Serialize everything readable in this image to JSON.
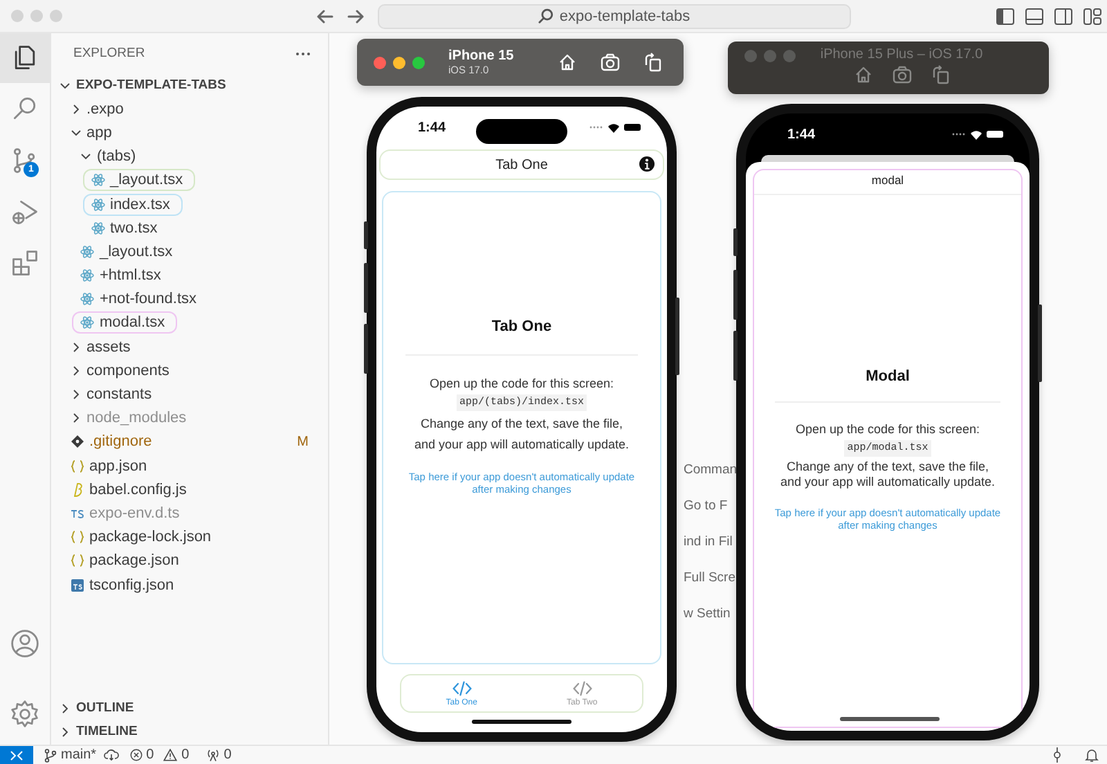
{
  "titlebar": {
    "search": "expo-template-tabs"
  },
  "activity_bar": [
    {
      "kind": "files",
      "selected": true
    },
    {
      "kind": "search",
      "selected": false
    },
    {
      "kind": "source-control",
      "selected": false,
      "badge": "1"
    },
    {
      "kind": "run",
      "selected": false
    },
    {
      "kind": "extensions",
      "selected": false
    },
    {
      "kind": "account",
      "selected": false
    },
    {
      "kind": "settings",
      "selected": false
    }
  ],
  "sidebar": {
    "title": "EXPLORER",
    "root": {
      "label": "EXPO-TEMPLATE-TABS",
      "kind": "folder",
      "expanded": true,
      "children": [
        {
          "label": ".expo",
          "kind": "folder",
          "expanded": false
        },
        {
          "label": "app",
          "kind": "folder",
          "expanded": true,
          "children": [
            {
              "label": "(tabs)",
              "kind": "folder",
              "expanded": true,
              "children": [
                {
                  "label": "_layout.tsx",
                  "kind": "react",
                  "color": "#d6e8c8"
                },
                {
                  "label": "index.tsx",
                  "kind": "react",
                  "color": "#bfe3f5"
                },
                {
                  "label": "two.tsx",
                  "kind": "react"
                }
              ]
            },
            {
              "label": "_layout.tsx",
              "kind": "react"
            },
            {
              "label": "+html.tsx",
              "kind": "react"
            },
            {
              "label": "+not-found.tsx",
              "kind": "react"
            },
            {
              "label": "modal.tsx",
              "kind": "react",
              "color": "#efc6f2"
            }
          ]
        },
        {
          "label": "assets",
          "kind": "folder",
          "expanded": false
        },
        {
          "label": "components",
          "kind": "folder",
          "expanded": false
        },
        {
          "label": "constants",
          "kind": "folder",
          "expanded": false
        },
        {
          "label": "node_modules",
          "kind": "folder",
          "expanded": false,
          "dimmed": true
        },
        {
          "label": ".gitignore",
          "kind": "git",
          "modified": true,
          "badge": "M"
        },
        {
          "label": "app.json",
          "kind": "json"
        },
        {
          "label": "babel.config.js",
          "kind": "babel"
        },
        {
          "label": "expo-env.d.ts",
          "kind": "ts",
          "dimmed": true
        },
        {
          "label": "package-lock.json",
          "kind": "json"
        },
        {
          "label": "package.json",
          "kind": "json"
        },
        {
          "label": "tsconfig.json",
          "kind": "tsconfig"
        }
      ]
    },
    "sections": [
      {
        "label": "OUTLINE",
        "expanded": false
      },
      {
        "label": "TIMELINE",
        "expanded": false
      }
    ]
  },
  "background_hints": [
    "Comman",
    "Go to F",
    "ind in Fil",
    "Full Scre",
    "w Settin"
  ],
  "simulators": [
    {
      "focused": true,
      "name": "iPhone 15",
      "os": "iOS 17.0",
      "screen": {
        "kind": "tabs",
        "time": "1:44",
        "header": "Tab One",
        "heading": "Tab One",
        "intro": "Open up the code for this screen:",
        "path": "app/(tabs)/index.tsx",
        "body": "Change any of the text, save the file, and your app will automatically update.",
        "link": "Tap here if your app doesn't automatically update after making changes",
        "tabs": [
          {
            "label": "Tab One",
            "selected": true
          },
          {
            "label": "Tab Two",
            "selected": false
          }
        ]
      }
    },
    {
      "focused": false,
      "title": "iPhone 15 Plus – iOS 17.0",
      "screen": {
        "kind": "modal",
        "time": "1:44",
        "header": "modal",
        "heading": "Modal",
        "intro": "Open up the code for this screen:",
        "path": "app/modal.tsx",
        "body": "Change any of the text, save the file, and your app will automatically update.",
        "link": "Tap here if your app doesn't automatically update after making changes"
      }
    }
  ],
  "status_bar": {
    "branch": "main*",
    "errors": "0",
    "warnings": "0",
    "ports": "0"
  }
}
